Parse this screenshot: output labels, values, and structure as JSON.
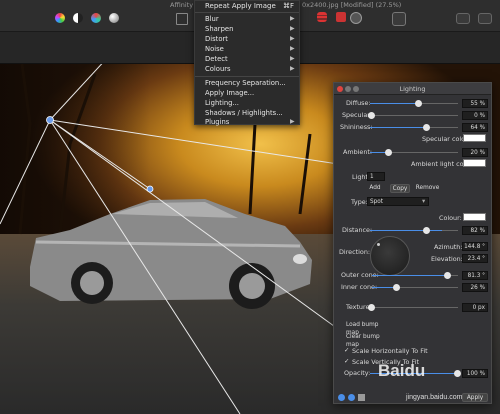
{
  "window": {
    "app_title_fragment": "Affinity P",
    "doc_title_fragment": "0x2400.jpg [Modified] (27.5%)"
  },
  "menu": {
    "top_item": "Repeat Apply Image",
    "top_shortcut": "⌘F",
    "items": [
      {
        "label": "Blur",
        "submenu": true
      },
      {
        "label": "Sharpen",
        "submenu": true
      },
      {
        "label": "Distort",
        "submenu": true
      },
      {
        "label": "Noise",
        "submenu": true
      },
      {
        "label": "Detect",
        "submenu": true
      },
      {
        "label": "Colours",
        "submenu": true
      },
      {
        "label": "Frequency Separation...",
        "submenu": false
      },
      {
        "label": "Apply Image...",
        "submenu": false
      },
      {
        "label": "Lighting...",
        "submenu": false
      },
      {
        "label": "Shadows / Highlights...",
        "submenu": false
      },
      {
        "label": "Plugins",
        "submenu": true
      }
    ]
  },
  "lighting": {
    "title": "Lighting",
    "diffuse": {
      "label": "Diffuse:",
      "value": "55 %",
      "fraction": 0.55
    },
    "specular": {
      "label": "Specular:",
      "value": "0 %",
      "fraction": 0.0
    },
    "shininess": {
      "label": "Shininess:",
      "value": "64 %",
      "fraction": 0.64
    },
    "specular_colour_label": "Specular colour:",
    "ambient": {
      "label": "Ambient:",
      "value": "20 %",
      "fraction": 0.2
    },
    "ambient_colour_label": "Ambient light colour:",
    "light_label": "Light:",
    "light_value": "1",
    "add_label": "Add",
    "copy_label": "Copy",
    "remove_label": "Remove",
    "type_label": "Type:",
    "type_value": "Spot",
    "colour_label": "Colour:",
    "distance": {
      "label": "Distance:",
      "value": "82 %",
      "fraction": 0.82
    },
    "direction_label": "Direction:",
    "azimuth_label": "Azimuth:",
    "azimuth_value": "144.8 °",
    "elevation_label": "Elevation:",
    "elevation_value": "23.4 °",
    "outer_cone": {
      "label": "Outer cone:",
      "value": "81.3 °",
      "fraction": 0.9
    },
    "inner_cone": {
      "label": "Inner cone:",
      "value": "26 %",
      "fraction": 0.26
    },
    "texture": {
      "label": "Texture:",
      "value": "0 px",
      "fraction": 0.0
    },
    "load_bump_map": "Load bump map",
    "clear_bump_map": "Clear bump map",
    "scale_h_label": "Scale Horizontally To Fit",
    "scale_v_label": "Scale Vertically To Fit",
    "opacity": {
      "label": "Opacity:",
      "value": "100 %",
      "fraction": 1.0
    },
    "apply_label": "Apply"
  },
  "watermark": {
    "brand": "Baidu",
    "sub": "jingyan.baidu.com"
  },
  "colors": {
    "accent": "#4a8ee8",
    "menu_bg": "#2b2b2b",
    "panel_bg": "#333336"
  }
}
